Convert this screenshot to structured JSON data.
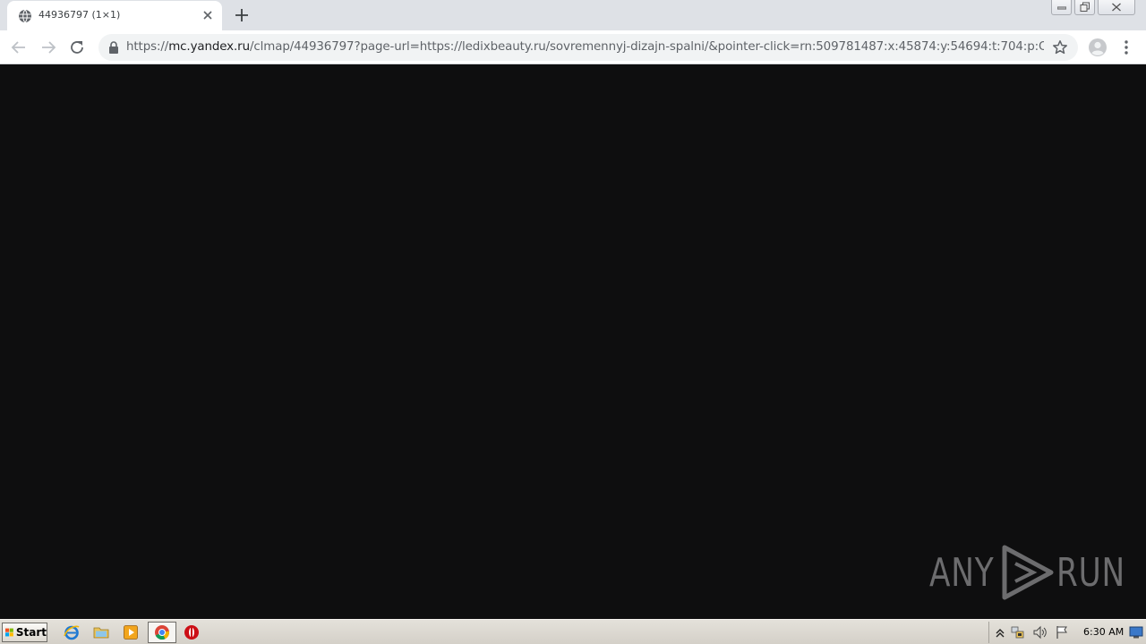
{
  "browser": {
    "tab": {
      "title": "44936797 (1×1)",
      "favicon": "globe-icon"
    },
    "address": {
      "scheme": "https://",
      "host": "mc.yandex.ru",
      "path": "/clmap/44936797?page-url=https://ledixbeauty.ru/sovremennyj-dizajn-spalni/&pointer-click=rn:509781487:x:45874:y:54694:t:704:p:O6S25..."
    },
    "icons": {
      "back": "back-arrow-icon",
      "forward": "forward-arrow-icon",
      "reload": "reload-icon",
      "lock": "lock-icon",
      "bookmark": "star-icon",
      "profile": "profile-icon",
      "menu": "kebab-menu-icon"
    }
  },
  "page": {
    "background": "#0e0e0f",
    "watermark": {
      "left": "ANY",
      "right": "RUN",
      "color": "#6c6c6e"
    }
  },
  "taskbar": {
    "start_label": "Start",
    "quick_launch": [
      "ie-icon",
      "folder-icon",
      "media-player-icon",
      "chrome-icon",
      "opera-icon"
    ],
    "tray": [
      "show-hidden-icon",
      "network-icon",
      "volume-icon",
      "flag-icon",
      "display-icon"
    ],
    "clock": "6:30 AM"
  }
}
